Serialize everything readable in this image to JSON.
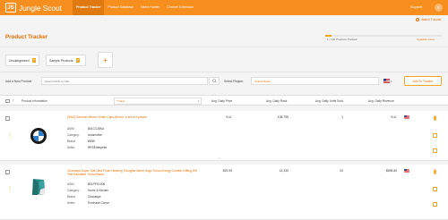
{
  "header": {
    "logo_mark": "JS",
    "logo_text": "Jungle Scout",
    "nav": [
      "Product Tracker",
      "Product Database",
      "Niche Hunter",
      "Chrome Extension"
    ],
    "support": "Support",
    "tutorial": "Watch Tutorial"
  },
  "page": {
    "title": "Product Tracker",
    "tracked_text": "1 / 140 Products Tracked",
    "tracked_fraction": 0.05,
    "upgrade": "Upgrade now ▸"
  },
  "categories": [
    {
      "label": "Uncategorized",
      "count": "2"
    },
    {
      "label": "Sample Products",
      "count": "2"
    }
  ],
  "add_product": {
    "label": "Add a New Product",
    "placeholder": "Search ASIN or URL",
    "region_label": "Select Region:",
    "region_value": "United States",
    "button": "Add To Tracker"
  },
  "table": {
    "headers": {
      "product_info": "Product Information",
      "days": "7 Days",
      "price": "Avg. Daily Price",
      "rank": "Avg. Daily Rank",
      "units": "Avg. Daily Units Sold",
      "revenue": "Avg. Daily Revenue"
    },
    "meta_labels": {
      "asin": "ASIN:",
      "category": "Category:",
      "brand": "Brand:",
      "seller": "Seller:"
    },
    "rows": [
      {
        "title": "(Set4) Genuine Wheel Center Caps 68 mm, a set of 4 pieces",
        "asin": "B01CC28KA",
        "category": "Automotive",
        "brand": "BMW",
        "seller": "RRSEnterprise",
        "price": "N.A.",
        "rank": "138,795",
        "units": "1",
        "revenue": "N.A."
      },
      {
        "title": "Chanasya Super Soft Ultra Plush Heading Thoughts Warm Hugs Throw Energy Comfort Gifting Gift Teal Microfiber Throw Blank...",
        "asin": "B01PPX1006",
        "category": "Home & Kitchen",
        "brand": "Chanasya",
        "seller": "Purchase Corner",
        "price": "$29.99",
        "rank": "14,330",
        "units": "20",
        "revenue": "$598.80"
      }
    ]
  },
  "colors": {
    "brand": "#f78f1e",
    "accent": "#e56e00"
  }
}
